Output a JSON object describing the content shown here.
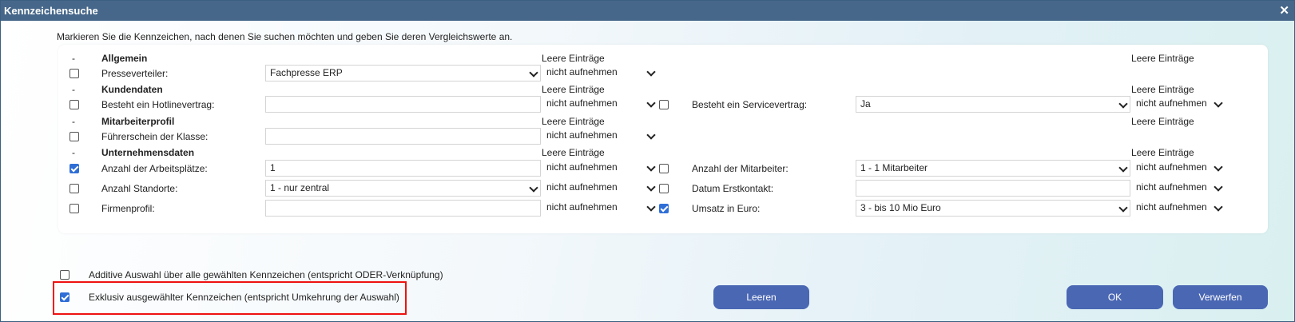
{
  "window": {
    "title": "Kennzeichensuche",
    "close_glyph": "✕"
  },
  "hint": "Markieren Sie die Kennzeichen, nach denen Sie suchen möchten und geben Sie deren Vergleichswerte an.",
  "leere_label": "Leere Einträge",
  "collapse_glyph": "-",
  "sections": {
    "allgemein": "Allgemein",
    "kundendaten": "Kundendaten",
    "mitarbeiterprofil": "Mitarbeiterprofil",
    "unternehmensdaten": "Unternehmensdaten"
  },
  "fields": {
    "presseverteiler": {
      "label": "Presseverteiler:",
      "value": "Fachpresse ERP",
      "empty": "nicht aufnehmen",
      "checked": false
    },
    "hotline": {
      "label": "Besteht ein Hotlinevertrag:",
      "value": "",
      "empty": "nicht aufnehmen",
      "checked": false
    },
    "service": {
      "label": "Besteht ein Servicevertrag:",
      "value": "Ja",
      "empty": "nicht aufnehmen",
      "checked": false
    },
    "fuehrerschein": {
      "label": "Führerschein der Klasse:",
      "value": "",
      "empty": "nicht aufnehmen",
      "checked": false
    },
    "arbeitsplaetze": {
      "label": "Anzahl der Arbeitsplätze:",
      "value": "1",
      "empty": "nicht aufnehmen",
      "checked": true
    },
    "mitarbeiter": {
      "label": "Anzahl der Mitarbeiter:",
      "value": "1 - 1 Mitarbeiter",
      "empty": "nicht aufnehmen",
      "checked": false
    },
    "standorte": {
      "label": "Anzahl Standorte:",
      "value": "1 - nur zentral",
      "empty": "nicht aufnehmen",
      "checked": false
    },
    "erstkontakt": {
      "label": "Datum Erstkontakt:",
      "value": "",
      "empty": "nicht aufnehmen",
      "checked": false
    },
    "firmenprofil": {
      "label": "Firmenprofil:",
      "value": "",
      "empty": "nicht aufnehmen",
      "checked": false
    },
    "umsatz": {
      "label": "Umsatz in Euro:",
      "value": "3 - bis 10 Mio Euro",
      "empty": "nicht aufnehmen",
      "checked": true
    }
  },
  "options": {
    "additive": {
      "label": "Additive Auswahl über alle gewählten Kennzeichen (entspricht ODER-Verknüpfung)",
      "checked": false
    },
    "exklusiv": {
      "label": "Exklusiv ausgewählter Kennzeichen (entspricht Umkehrung der Auswahl)",
      "checked": true
    }
  },
  "buttons": {
    "leeren": "Leeren",
    "ok": "OK",
    "verwerfen": "Verwerfen"
  },
  "colors": {
    "titlebar": "#46678a",
    "button": "#4a67b3",
    "checkbox_on": "#2f6ed6",
    "highlight": "#e11111"
  }
}
